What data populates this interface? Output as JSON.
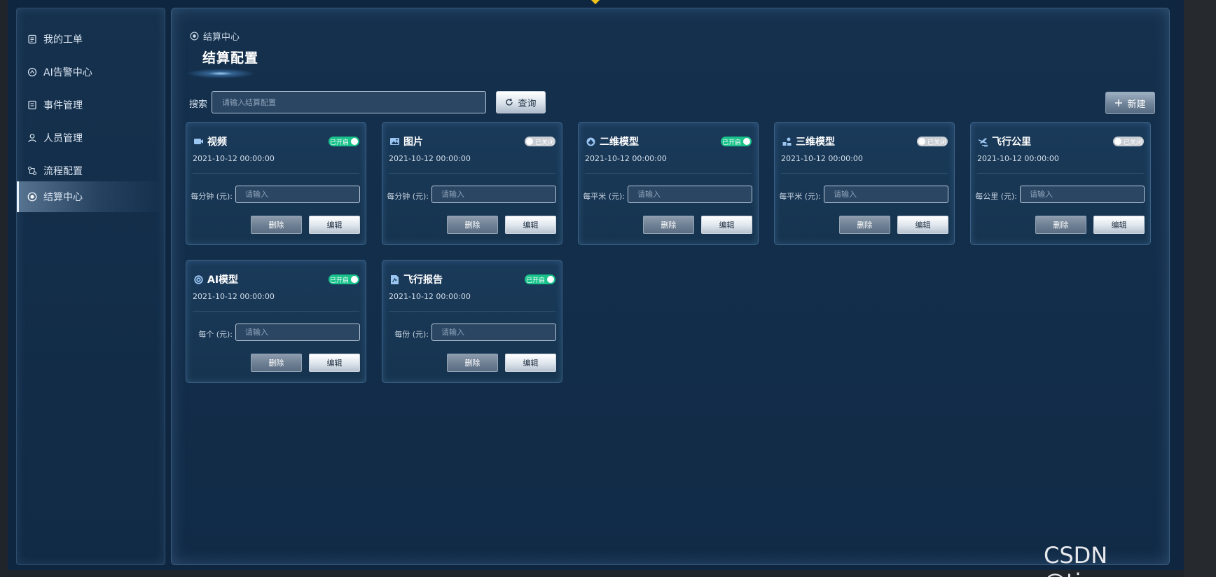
{
  "sidebar": {
    "items": [
      {
        "label": "我的工单",
        "icon": "ticket-icon"
      },
      {
        "label": "AI告警中心",
        "icon": "alarm-icon"
      },
      {
        "label": "事件管理",
        "icon": "event-icon"
      },
      {
        "label": "人员管理",
        "icon": "user-icon"
      },
      {
        "label": "流程配置",
        "icon": "flow-icon"
      },
      {
        "label": "结算中心",
        "icon": "settlement-icon",
        "active": true
      }
    ]
  },
  "breadcrumb": "结算中心",
  "page_title": "结算配置",
  "search": {
    "label": "搜索",
    "placeholder": "请输入结算配置",
    "query_label": "查询"
  },
  "new_label": "新建",
  "cards": [
    {
      "title": "视频",
      "icon": "video-icon",
      "status": "已开启",
      "enabled": true,
      "time": "2021-10-12  00:00:00",
      "unit_label": "每分钟 (元):",
      "placeholder": "请输入",
      "delete_label": "删除",
      "edit_label": "编辑"
    },
    {
      "title": "图片",
      "icon": "image-icon",
      "status": "已关闭",
      "enabled": false,
      "time": "2021-10-12  00:00:00",
      "unit_label": "每分钟 (元):",
      "placeholder": "请输入",
      "delete_label": "删除",
      "edit_label": "编辑"
    },
    {
      "title": "二维模型",
      "icon": "2d-model-icon",
      "status": "已开启",
      "enabled": true,
      "time": "2021-10-12  00:00:00",
      "unit_label": "每平米 (元):",
      "placeholder": "请输入",
      "delete_label": "删除",
      "edit_label": "编辑"
    },
    {
      "title": "三维模型",
      "icon": "3d-model-icon",
      "status": "已关闭",
      "enabled": false,
      "time": "2021-10-12  00:00:00",
      "unit_label": "每平米 (元):",
      "placeholder": "请输入",
      "delete_label": "删除",
      "edit_label": "编辑"
    },
    {
      "title": "飞行公里",
      "icon": "flight-icon",
      "status": "已关闭",
      "enabled": false,
      "time": "2021-10-12  00:00:00",
      "unit_label": "每公里 (元):",
      "placeholder": "请输入",
      "delete_label": "删除",
      "edit_label": "编辑"
    },
    {
      "title": "AI模型",
      "icon": "ai-model-icon",
      "status": "已开启",
      "enabled": true,
      "time": "2021-10-12  00:00:00",
      "unit_label": "每个 (元):",
      "placeholder": "请输入",
      "delete_label": "删除",
      "edit_label": "编辑"
    },
    {
      "title": "飞行报告",
      "icon": "report-icon",
      "status": "已开启",
      "enabled": true,
      "time": "2021-10-12  00:00:00",
      "unit_label": "每份 (元):",
      "placeholder": "请输入",
      "delete_label": "删除",
      "edit_label": "编辑"
    }
  ],
  "watermark": "CSDN @tigerups",
  "colors": {
    "enabled_toggle": "#19c28a",
    "disabled_toggle": "#c8cdd3",
    "panel_bg": "#14304d",
    "accent_marker": "#f2c318"
  }
}
